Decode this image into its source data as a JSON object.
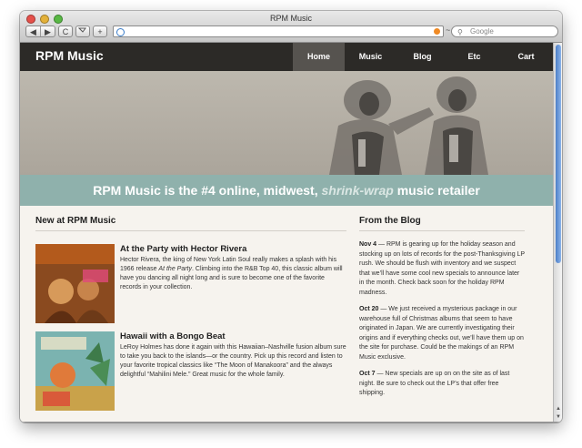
{
  "window": {
    "title": "RPM Music"
  },
  "toolbar": {
    "back": "◀",
    "forward": "▶",
    "reload": "C",
    "add_bookmark": "+",
    "url": "",
    "search_placeholder": "Google",
    "url_extra": "~"
  },
  "site": {
    "brand": "RPM Music",
    "nav": [
      "Home",
      "Music",
      "Blog",
      "Etc",
      "Cart"
    ],
    "active_nav": "Home",
    "tagline_before": "RPM Music is the #4 online, midwest, ",
    "tagline_em": "shrink-wrap",
    "tagline_after": " music retailer"
  },
  "releases": {
    "heading": "New at RPM Music",
    "items": [
      {
        "title": "At the Party with Hector Rivera",
        "desc_1": "Hector Rivera, the king of New York Latin Soul really makes a splash with his 1966 release ",
        "desc_em": "At the Party",
        "desc_2": ". Climbing into the R&B Top 40, this classic album will have you dancing all night long and is sure to become one of the favorite records in your collection.",
        "cover_text": "at the Party"
      },
      {
        "title": "Hawaii with a Bongo Beat",
        "desc_1": "LeRoy Holmes has done it again with this Hawaiian–Nashville fusion album sure to take you back to the islands—or the country. Pick up this record and listen to your favorite tropical classics like “The Moon of Manakoora” and the always delightful “Mahilini Mele.” Great music for the whole family.",
        "desc_em": "",
        "desc_2": "",
        "cover_text": "HAWAII WITH A BONGO BEAT"
      }
    ]
  },
  "blog": {
    "heading": "From the Blog",
    "posts": [
      {
        "date": "Nov 4",
        "text": " — RPM is gearing up for the holiday season and stocking up on lots of records for the post-Thanksgiving LP rush. We should be flush with inventory and we suspect that we’ll have some cool new specials to announce later in the month. Check back soon for the holiday RPM madness."
      },
      {
        "date": "Oct 20",
        "text": " — We just received a mysterious package in our warehouse full of Christmas albums that seem to have originated in Japan. We are currently investigating their origins and if everything checks out, we’ll have them up on the site for purchase. Could be the makings of an RPM Music exclusive."
      },
      {
        "date": "Oct 7",
        "text": " — New specials are up on on the site as of last night. Be sure to check out the LP’s that offer free shipping."
      }
    ]
  },
  "colors": {
    "nav_bg": "#2c2a27",
    "nav_active": "#56534f",
    "tagline_bg": "#8fb1ac",
    "page_bg": "#f6f3ee"
  }
}
